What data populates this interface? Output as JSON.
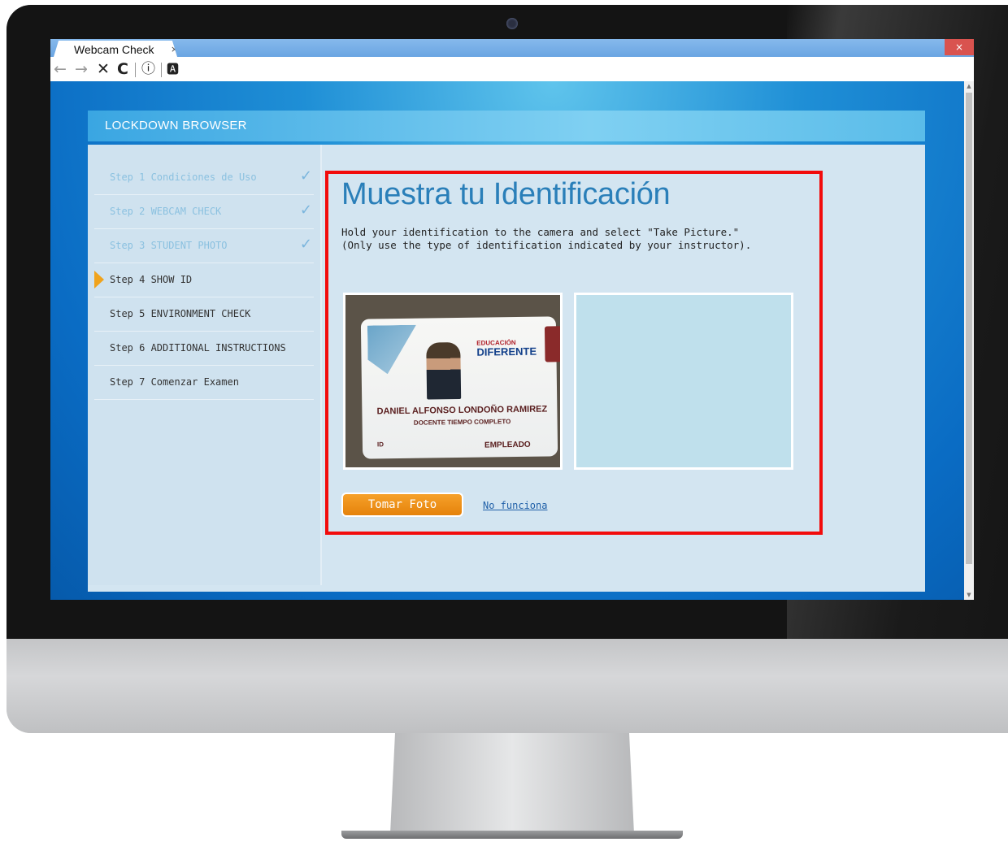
{
  "browser": {
    "tab_title": "Webcam Check",
    "tab_close": "×",
    "window_close": "×",
    "toolbar": {
      "back": "←",
      "forward": "→",
      "stop": "✕",
      "reload": "C",
      "info": "ⓘ",
      "reader": "🅰"
    }
  },
  "app": {
    "header_title": "LOCKDOWN BROWSER",
    "steps": [
      {
        "label": "Step 1  Condiciones de Uso",
        "state": "done"
      },
      {
        "label": "Step 2  WEBCAM CHECK",
        "state": "done"
      },
      {
        "label": "Step 3  STUDENT PHOTO",
        "state": "done"
      },
      {
        "label": "Step 4  SHOW ID",
        "state": "current"
      },
      {
        "label": "Step 5  ENVIRONMENT CHECK",
        "state": "pending"
      },
      {
        "label": "Step 6  ADDITIONAL INSTRUCTIONS",
        "state": "pending"
      },
      {
        "label": "Step 7  Comenzar Examen",
        "state": "pending"
      }
    ],
    "check_mark": "✓",
    "content": {
      "title": "Muestra tu Identificación",
      "description_line1": "Hold your identification to the camera and select \"Take Picture.\"",
      "description_line2": "(Only use the type of identification indicated by your instructor).",
      "take_photo_label": "Tomar Foto",
      "not_working_label": "No funciona"
    },
    "id_card": {
      "brand_top": "EDUCACIÓN",
      "brand_main": "DIFERENTE",
      "name": "DANIEL ALFONSO LONDOÑO RAMIREZ",
      "role": "DOCENTE TIEMPO COMPLETO",
      "id_label": "ID",
      "employee": "EMPLEADO"
    }
  },
  "colors": {
    "accent_orange": "#e5820b",
    "highlight_red": "#f20c0c",
    "title_blue": "#2a7fb9"
  }
}
